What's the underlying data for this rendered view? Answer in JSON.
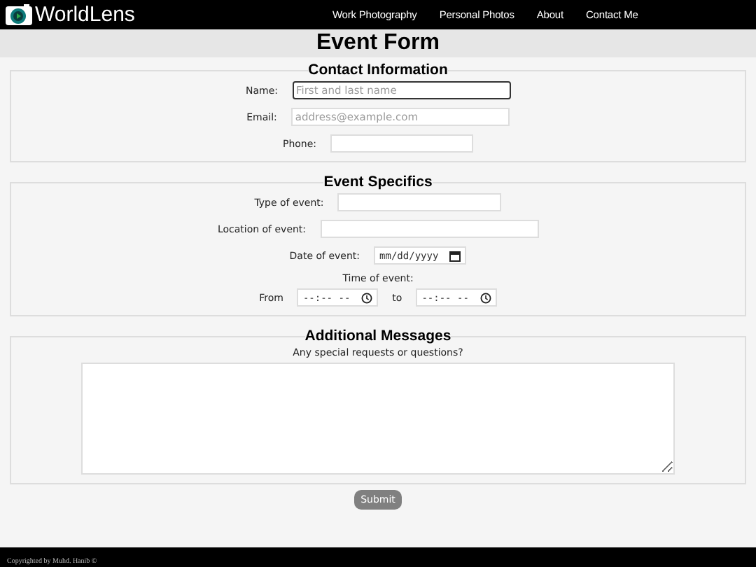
{
  "nav": {
    "brand": "WorldLens",
    "links": [
      "Work Photography",
      "Personal Photos",
      "About",
      "Contact Me"
    ]
  },
  "page_title": "Event Form",
  "sections": [
    {
      "legend": "Contact Information",
      "fields": [
        {
          "kind": "text",
          "label": "Name:",
          "placeholder": "First and last name",
          "focused": true
        },
        {
          "kind": "text",
          "label": "Email:",
          "placeholder": "address@example.com",
          "focused": false
        },
        {
          "kind": "text",
          "label": "Phone:",
          "focused": false
        }
      ]
    },
    {
      "legend": "Event Specifics",
      "fields": [
        {
          "kind": "text",
          "label": "Type of event:",
          "focused": false
        },
        {
          "kind": "text",
          "label": "Location of event:",
          "focused": false
        },
        {
          "kind": "date",
          "label": "Date of event:",
          "placeholder": "mm/dd/yyyy"
        },
        {
          "kind": "timerange",
          "label": "Time of event:",
          "from_label": "From",
          "from_placeholder": "--:-- --",
          "to_label": "to",
          "to_placeholder": "--:-- --"
        }
      ]
    },
    {
      "legend": "Additional Messages",
      "fields": [
        {
          "kind": "textarea",
          "label": "Any special requests or questions?"
        }
      ]
    }
  ],
  "submit": "Submit",
  "footer": "Copyrighted by Muhd. Hanib ©"
}
